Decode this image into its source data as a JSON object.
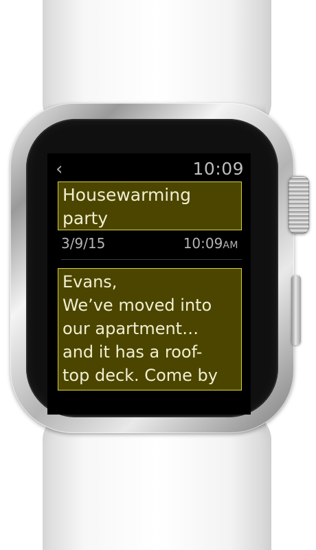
{
  "device": {
    "name": "Apple Watch"
  },
  "status": {
    "back_glyph": "‹",
    "time": "10:09"
  },
  "message": {
    "subject": "Housewarming\nparty",
    "date": "3/9/15",
    "time": "10:09",
    "ampm": "AM",
    "body": "Evans,\nWe’ve moved into\nour apartment…\nand it has a roof-\ntop deck. Come by"
  },
  "colors": {
    "screen_background": "#000000",
    "highlight_fill": "#4b4500",
    "highlight_border": "#d6d63a",
    "text_primary": "#f1efcf",
    "text_secondary": "#b5b5b5"
  },
  "icons": {
    "back": "back-chevron-icon"
  }
}
